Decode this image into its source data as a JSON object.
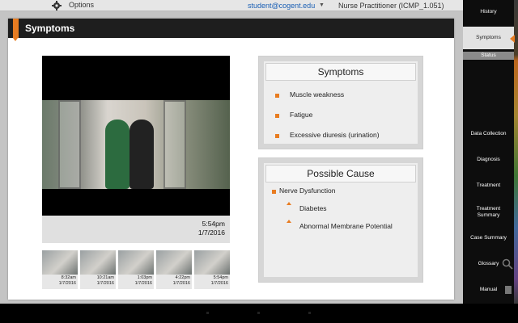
{
  "topbar": {
    "options_label": "Options",
    "email": "student@cogent.edu",
    "course": "Nurse Practitioner (ICMP_1.051)"
  },
  "card": {
    "title": "Symptoms"
  },
  "video": {
    "time": "5:54pm",
    "date": "1/7/2016"
  },
  "thumbnails": [
    {
      "time": "8:32am",
      "date": "1/7/2016"
    },
    {
      "time": "10:21am",
      "date": "1/7/2016"
    },
    {
      "time": "1:03pm",
      "date": "1/7/2016"
    },
    {
      "time": "4:22pm",
      "date": "1/7/2016"
    },
    {
      "time": "5:54pm",
      "date": "1/7/2016"
    }
  ],
  "symptoms_panel": {
    "title": "Symptoms",
    "items": [
      "Muscle weakness",
      "Fatigue",
      "Excessive diuresis (urination)"
    ]
  },
  "cause_panel": {
    "title": "Possible Cause",
    "main": "Nerve Dysfunction",
    "subs": [
      "Diabetes",
      "Abnormal Membrane Potential"
    ]
  },
  "sidebar": {
    "items": [
      "History",
      "Symptoms",
      "Status",
      "Data Collection",
      "Diagnosis",
      "Treatment",
      "Treatment Summary",
      "Case Summary",
      "Glossary",
      "Manual"
    ]
  },
  "colors": {
    "accent": "#e87c21",
    "header": "#1e1e1e",
    "link": "#1a5fb4"
  }
}
